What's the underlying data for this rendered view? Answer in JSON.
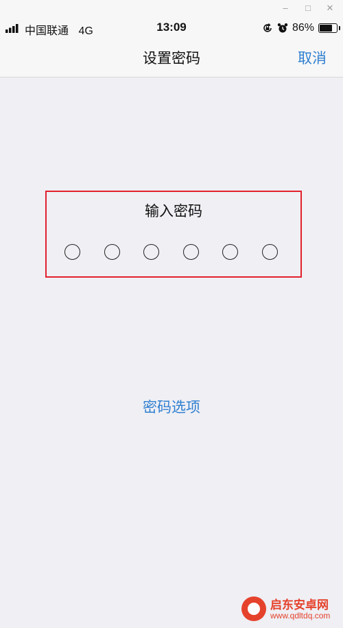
{
  "window": {
    "minimize": "–",
    "maximize": "□",
    "close": "✕"
  },
  "status_bar": {
    "carrier": "中国联通",
    "network": "4G",
    "time": "13:09",
    "battery_percent_label": "86%",
    "battery_level": 0.86,
    "icons": [
      "signal-icon",
      "rotation-lock-icon",
      "alarm-icon",
      "battery-icon"
    ]
  },
  "nav": {
    "title": "设置密码",
    "cancel": "取消"
  },
  "passcode": {
    "prompt": "输入密码",
    "digits_total": 6,
    "digits_entered": 0
  },
  "options_link": "密码选项",
  "watermark": {
    "title": "启东安卓网",
    "url": "www.qdltdq.com"
  },
  "colors": {
    "accent": "#2f7fd0",
    "highlight_border": "#e2202c",
    "background": "#efeff4",
    "bar_background": "#f7f7f7"
  }
}
